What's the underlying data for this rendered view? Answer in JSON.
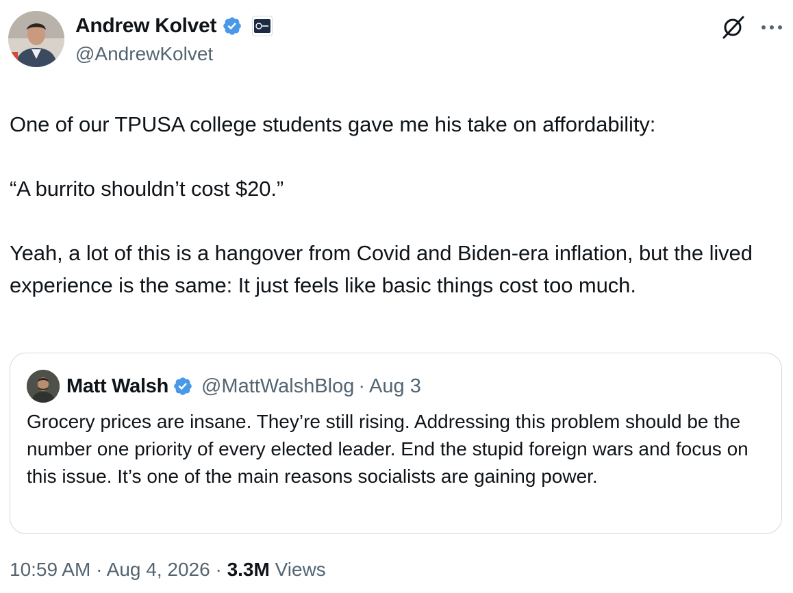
{
  "author": {
    "name": "Andrew Kolvet",
    "handle": "@AndrewKolvet",
    "verified_color": "#4a99e9"
  },
  "tweet": {
    "paragraphs": [
      "One of our TPUSA college students gave me his take on affordability:",
      "“A burrito shouldn’t cost $20.”",
      "Yeah, a lot of this is a hangover from Covid and Biden-era inflation, but the lived experience is the same: It just feels like basic things cost too much."
    ]
  },
  "quote": {
    "name": "Matt Walsh",
    "handle": "@MattWalshBlog",
    "separator": "·",
    "date": "Aug 3",
    "text": "Grocery prices are insane. They’re still rising. Addressing this problem should be the number one priority of every elected leader. End the stupid foreign wars and focus on this issue. It’s one of the main reasons socialists are gaining power."
  },
  "footer": {
    "time": "10:59 AM",
    "sep1": "·",
    "date": "Aug 4, 2026",
    "sep2": "·",
    "views_count": "3.3M",
    "views_label": "Views"
  },
  "icons": {
    "verified": "verified-badge-icon",
    "affiliate": "affiliate-badge-icon",
    "grok": "grok-icon",
    "more": "more-icon"
  },
  "colors": {
    "text": "#0f1419",
    "secondary": "#536471",
    "border": "#cfd9de",
    "verified": "#4a99e9"
  }
}
